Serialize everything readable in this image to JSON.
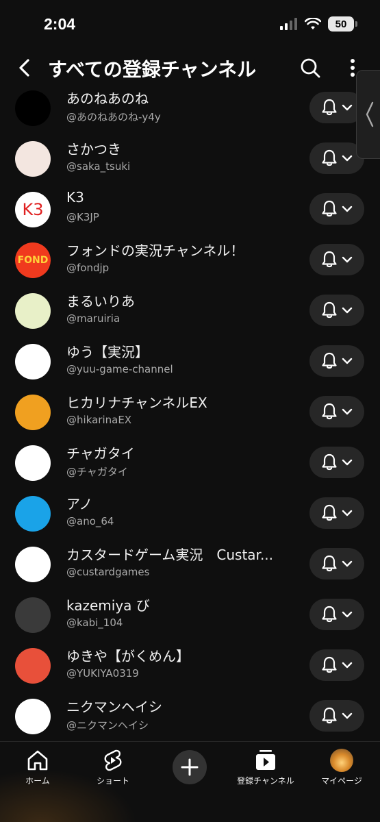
{
  "status": {
    "time": "2:04",
    "battery": "50"
  },
  "header": {
    "title": "すべての登録チャンネル"
  },
  "channels": [
    {
      "name": "あのねあのね",
      "handle": "@あのねあのね-y4y",
      "avatar_text": "",
      "avatar_bg": "#000000",
      "avatar_fg": "#ffffff"
    },
    {
      "name": "さかつき",
      "handle": "@saka_tsuki",
      "avatar_text": "",
      "avatar_bg": "#f3e6e0",
      "avatar_fg": "#3344aa"
    },
    {
      "name": "K3",
      "handle": "@K3JP",
      "avatar_text": "K3",
      "avatar_bg": "#ffffff",
      "avatar_fg": "#e02020"
    },
    {
      "name": "フォンドの実況チャンネル！",
      "handle": "@fondjp",
      "avatar_text": "FOND",
      "avatar_bg": "#f03a1e",
      "avatar_fg": "#ffd23a"
    },
    {
      "name": "まるいりあ",
      "handle": "@maruiria",
      "avatar_text": "",
      "avatar_bg": "#e8f0c8",
      "avatar_fg": "#e05a7a"
    },
    {
      "name": "ゆう【実況】",
      "handle": "@yuu-game-channel",
      "avatar_text": "",
      "avatar_bg": "#ffffff",
      "avatar_fg": "#8a5a3a"
    },
    {
      "name": "ヒカリナチャンネルEX",
      "handle": "@hikarinaEX",
      "avatar_text": "",
      "avatar_bg": "#f0a020",
      "avatar_fg": "#ffffff"
    },
    {
      "name": "チャガタイ",
      "handle": "@チャガタイ",
      "avatar_text": "",
      "avatar_bg": "#ffffff",
      "avatar_fg": "#111111"
    },
    {
      "name": "アノ",
      "handle": "@ano_64",
      "avatar_text": "",
      "avatar_bg": "#1aa3e8",
      "avatar_fg": "#000000"
    },
    {
      "name": "カスタードゲーム実況　Custar...",
      "handle": "@custardgames",
      "avatar_text": "",
      "avatar_bg": "#ffffff",
      "avatar_fg": "#1a2a6a"
    },
    {
      "name": "kazemiya び",
      "handle": "@kabi_104",
      "avatar_text": "",
      "avatar_bg": "#3a3a3a",
      "avatar_fg": "#d9a54a"
    },
    {
      "name": "ゆきや【がくめん】",
      "handle": "@YUKIYA0319",
      "avatar_text": "",
      "avatar_bg": "#e8503a",
      "avatar_fg": "#ffffff"
    },
    {
      "name": "ニクマンヘイシ",
      "handle": "@ニクマンヘイシ",
      "avatar_text": "",
      "avatar_bg": "#ffffff",
      "avatar_fg": "#4a9ad8"
    }
  ],
  "nav": {
    "home": "ホーム",
    "shorts": "ショート",
    "subscriptions": "登録チャンネル",
    "you": "マイページ"
  },
  "icons": {
    "back": "chevron-left-icon",
    "search": "search-icon",
    "more": "more-vert-icon",
    "bell": "bell-icon",
    "chevron": "chevron-down-icon",
    "home": "home-icon",
    "shorts": "shorts-icon",
    "create": "plus-icon",
    "subscriptions": "subscriptions-icon"
  }
}
